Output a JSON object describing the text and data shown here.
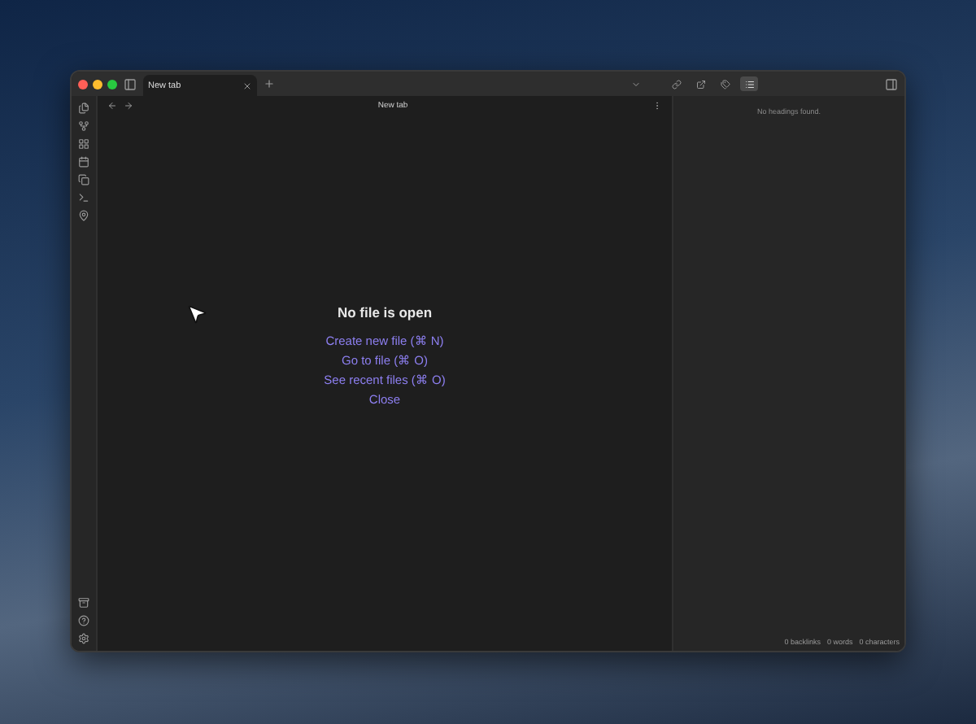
{
  "tabs": [
    {
      "label": "New tab",
      "selected": true
    }
  ],
  "view_title": "New tab",
  "right_panel_tabs": [
    {
      "kind": "links",
      "selected": false
    },
    {
      "kind": "outgoing",
      "selected": false
    },
    {
      "kind": "tags",
      "selected": false
    },
    {
      "kind": "outline",
      "selected": true
    }
  ],
  "right_panel": {
    "message": "No headings found."
  },
  "empty_state": {
    "title": "No file is open",
    "actions": [
      "Create new file (⌘ N)",
      "Go to file (⌘ O)",
      "See recent files (⌘ O)",
      "Close"
    ]
  },
  "status_bar": [
    "0 backlinks",
    "0 words",
    "0 characters"
  ]
}
